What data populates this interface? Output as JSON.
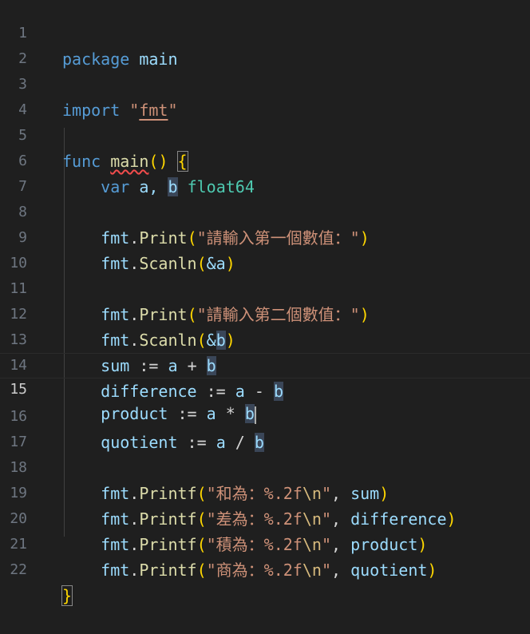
{
  "line_numbers": [
    "1",
    "2",
    "3",
    "4",
    "5",
    "6",
    "7",
    "8",
    "9",
    "10",
    "11",
    "12",
    "13",
    "14",
    "15",
    "16",
    "17",
    "18",
    "19",
    "20",
    "21",
    "22"
  ],
  "active_line": "15",
  "colors": {
    "background": "#1f1f1f",
    "keyword": "#569cd6",
    "function": "#dcdcaa",
    "identifier": "#9cdcfe",
    "type": "#4ec9b0",
    "string": "#ce9178",
    "bracket": "#ffd700",
    "paren": "#da70d6",
    "highlight": "#3a4658"
  },
  "code": {
    "l1": {
      "kw": "package",
      "id": "main"
    },
    "l3": {
      "kw": "import",
      "str_open": "\"",
      "str_val": "fmt",
      "str_close": "\""
    },
    "l5": {
      "kw": "func",
      "fn": "main",
      "paren_open": "(",
      "paren_close": ")",
      "brace": "{"
    },
    "l6": {
      "kw": "var",
      "a": "a,",
      "b": "b",
      "type": "float64"
    },
    "l8": {
      "pkg": "fmt",
      "dot": ".",
      "fn": "Print",
      "str": "\"請輸入第一個數值：\""
    },
    "l9": {
      "pkg": "fmt",
      "dot": ".",
      "fn": "Scanln",
      "arg": "&a"
    },
    "l11": {
      "pkg": "fmt",
      "dot": ".",
      "fn": "Print",
      "str": "\"請輸入第二個數值：\""
    },
    "l12": {
      "pkg": "fmt",
      "dot": ".",
      "fn": "Scanln",
      "amp": "&",
      "b": "b"
    },
    "l13": {
      "lhs": "sum",
      "op": ":=",
      "a": "a",
      "op2": "+",
      "b": "b"
    },
    "l14": {
      "lhs": "difference",
      "op": ":=",
      "a": "a",
      "op2": "-",
      "b": "b"
    },
    "l15": {
      "lhs": "product",
      "op": ":=",
      "a": "a",
      "op2": "*",
      "b": "b"
    },
    "l16": {
      "lhs": "quotient",
      "op": ":=",
      "a": "a",
      "op2": "/",
      "b": "b"
    },
    "l18": {
      "pkg": "fmt",
      "dot": ".",
      "fn": "Printf",
      "str": "\"和為：%.2f",
      "esc": "\\n",
      "str_end": "\"",
      "comma": ",",
      "arg": "sum"
    },
    "l19": {
      "pkg": "fmt",
      "dot": ".",
      "fn": "Printf",
      "str": "\"差為：%.2f",
      "esc": "\\n",
      "str_end": "\"",
      "comma": ",",
      "arg": "difference"
    },
    "l20": {
      "pkg": "fmt",
      "dot": ".",
      "fn": "Printf",
      "str": "\"積為：%.2f",
      "esc": "\\n",
      "str_end": "\"",
      "comma": ",",
      "arg": "product"
    },
    "l21": {
      "pkg": "fmt",
      "dot": ".",
      "fn": "Printf",
      "str": "\"商為：%.2f",
      "esc": "\\n",
      "str_end": "\"",
      "comma": ",",
      "arg": "quotient"
    },
    "l22": {
      "brace": "}"
    }
  }
}
